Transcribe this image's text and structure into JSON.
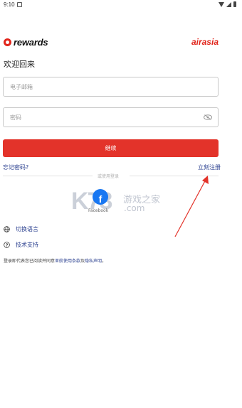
{
  "status_bar": {
    "time": "9:10"
  },
  "header": {
    "brand_left": "rewards",
    "brand_right": "airasia"
  },
  "login": {
    "welcome": "欢迎回来",
    "email_placeholder": "电子邮箱",
    "password_placeholder": "密码",
    "continue_label": "继续",
    "forgot_password": "忘记密码?",
    "register": "立刻注册",
    "or_login_with": "或使用登录",
    "facebook_label": "Facebook"
  },
  "options": {
    "language": "切换语言",
    "support": "技术支持"
  },
  "terms": {
    "prefix": "登录即代表您已阅读并同意",
    "terms_link": "亚航使用条款",
    "joiner": "及",
    "privacy_link": "隐私声明",
    "suffix": "。"
  },
  "watermark": {
    "logo": "K73",
    "cn": "游戏之家",
    "domain": ".com"
  },
  "colors": {
    "brand_red": "#e3332a",
    "link_blue": "#2a3f8f",
    "facebook_blue": "#1877f2"
  }
}
